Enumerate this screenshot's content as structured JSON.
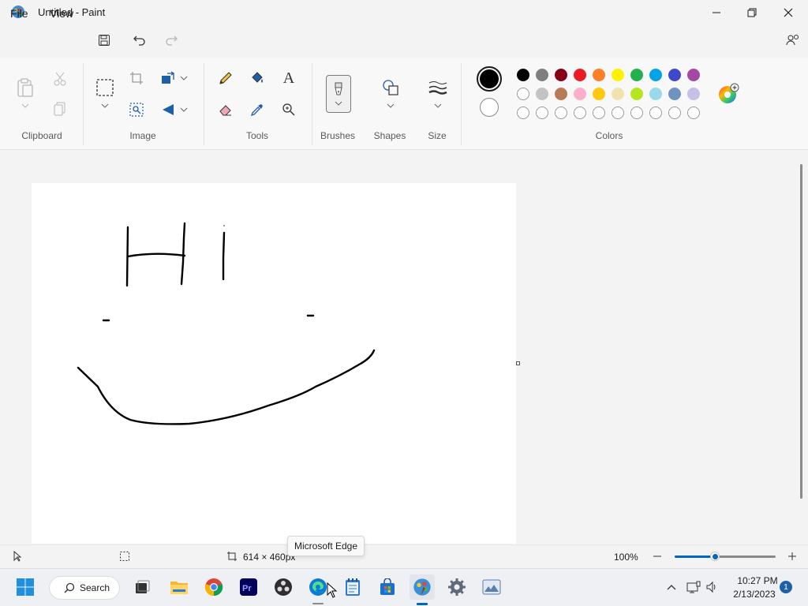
{
  "window": {
    "title": "Untitled - Paint"
  },
  "menu": {
    "file": "File",
    "view": "View"
  },
  "ribbon": {
    "groups": {
      "clipboard": "Clipboard",
      "image": "Image",
      "tools": "Tools",
      "brushes": "Brushes",
      "shapes": "Shapes",
      "size": "Size",
      "colors": "Colors"
    },
    "tools": {
      "text_glyph": "A"
    },
    "colors": {
      "primary": "#000000",
      "secondary": "#ffffff",
      "palette_row1": [
        "#000000",
        "#7f7f7f",
        "#880015",
        "#ed1c24",
        "#ff7f27",
        "#fff200",
        "#22b14c",
        "#00a2e8",
        "#3f48cc",
        "#a349a4"
      ],
      "palette_row2": [
        "#ffffff",
        "#c3c3c3",
        "#b97a57",
        "#ffaec9",
        "#ffc90e",
        "#efe4b0",
        "#b5e61d",
        "#99d9ea",
        "#7092be",
        "#c8bfe7"
      ],
      "palette_row3_count": 10
    }
  },
  "statusbar": {
    "canvas_size": "614 × 460px",
    "zoom": "100%",
    "zoom_level_fraction": 0.4
  },
  "tooltip": {
    "text": "Microsoft Edge"
  },
  "taskbar": {
    "search_label": "Search",
    "time": "10:27 PM",
    "date": "2/13/2023",
    "notifications": "1"
  }
}
